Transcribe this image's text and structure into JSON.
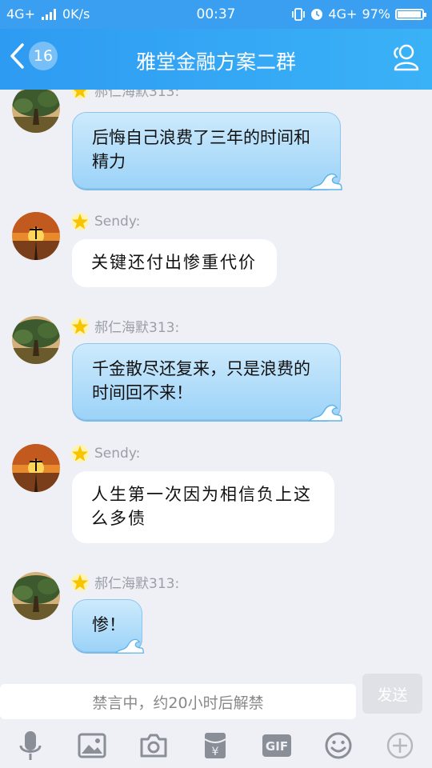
{
  "status_bar": {
    "network_left": "4G+",
    "speed": "0K/s",
    "time": "00:37",
    "network_right": "4G+",
    "battery": "97%",
    "battery_level": 0.97
  },
  "header": {
    "unread_count": "16",
    "title": "雅堂金融方案二群",
    "back_icon": "chevron-left-icon",
    "group_icon": "group-members-icon"
  },
  "messages": [
    {
      "sender": "郝仁海默313:",
      "text": "后悔自己浪费了三年的时间和精力",
      "style": "blue"
    },
    {
      "sender": "Sendy:",
      "text": "关键还付出惨重代价",
      "style": "white"
    },
    {
      "sender": "郝仁海默313:",
      "text": "千金散尽还复来，只是浪费的时间回不来！",
      "style": "blue"
    },
    {
      "sender": "Sendy:",
      "text": "人生第一次因为相信负上这么多债",
      "style": "white"
    },
    {
      "sender": "郝仁海默313:",
      "text": "惨！",
      "style": "blue"
    }
  ],
  "input": {
    "placeholder": "禁言中，约20小时后解禁",
    "send_label": "发送"
  },
  "toolbar": {
    "items": [
      "microphone-icon",
      "image-icon",
      "camera-icon",
      "red-packet-icon",
      "gif-icon",
      "emoji-icon",
      "plus-icon"
    ],
    "gif_label": "GIF"
  },
  "colors": {
    "header": "#3ab2f7",
    "bubble_blue": "#a9d9f9",
    "star": "#f8c400"
  }
}
